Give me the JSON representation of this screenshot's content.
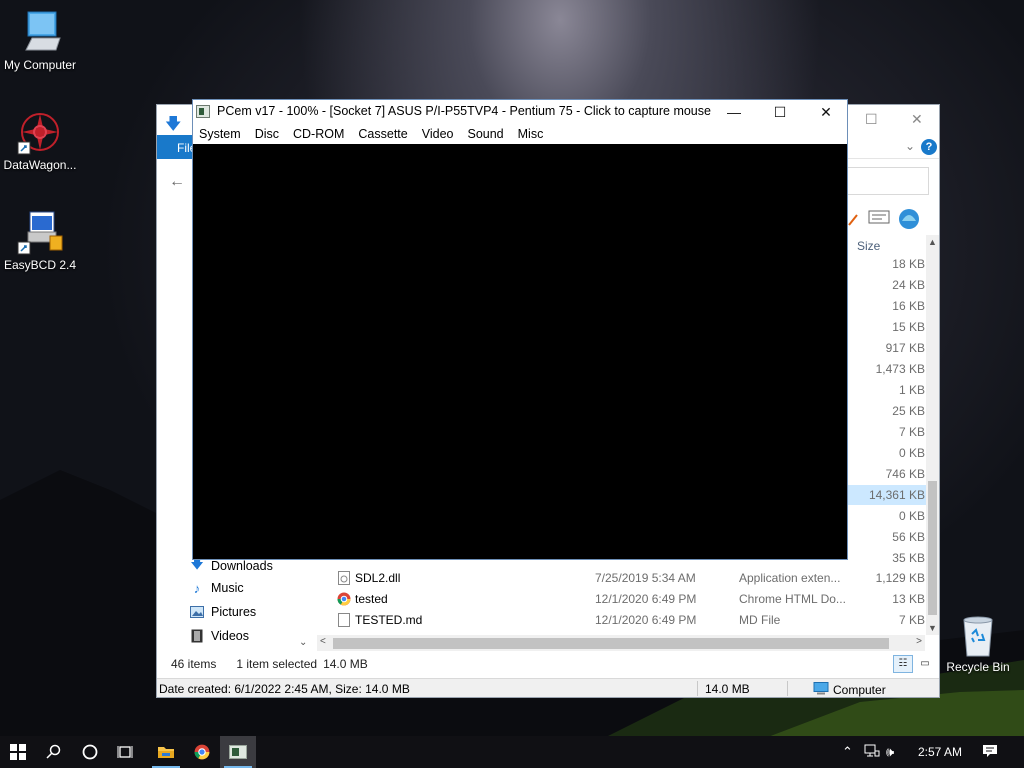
{
  "desktop": {
    "icons": [
      {
        "label": "My Computer"
      },
      {
        "label": "DataWagon..."
      },
      {
        "label": "EasyBCD 2.4"
      },
      {
        "label": "Recycle Bin"
      }
    ]
  },
  "pcem": {
    "title": "PCem v17 - 100% - [Socket 7] ASUS P/I-P55TVP4 - Pentium 75 - Click to capture mouse",
    "minimize": "—",
    "maximize": "☐",
    "close": "✕",
    "menu": [
      "System",
      "Disc",
      "CD-ROM",
      "Cassette",
      "Video",
      "Sound",
      "Misc"
    ]
  },
  "explorer": {
    "ribbon_tab": "File",
    "column_size": "Size",
    "sizes": [
      "18 KB",
      "24 KB",
      "16 KB",
      "15 KB",
      "917 KB",
      "1,473 KB",
      "1 KB",
      "25 KB",
      "7 KB",
      "0 KB",
      "746 KB",
      "14,361 KB",
      "0 KB",
      "56 KB",
      "35 KB"
    ],
    "nav": [
      {
        "label": "Downloads",
        "icon": "download-icon"
      },
      {
        "label": "Music",
        "icon": "music-icon"
      },
      {
        "label": "Pictures",
        "icon": "pictures-icon"
      },
      {
        "label": "Videos",
        "icon": "videos-icon"
      }
    ],
    "files": [
      {
        "name": "SDL2.dll",
        "date": "7/25/2019 5:34 AM",
        "type": "Application exten...",
        "size": "1,129 KB"
      },
      {
        "name": "tested",
        "date": "12/1/2020 6:49 PM",
        "type": "Chrome HTML Do...",
        "size": "13 KB"
      },
      {
        "name": "TESTED.md",
        "date": "12/1/2020 6:49 PM",
        "type": "MD File",
        "size": "7 KB"
      }
    ],
    "status": {
      "items": "46 items",
      "selected": "1 item selected",
      "selected_size": "14.0 MB"
    },
    "details": {
      "info": "Date created: 6/1/2022 2:45 AM, Size: 14.0 MB",
      "size": "14.0 MB",
      "location": "Computer"
    }
  },
  "taskbar": {
    "clock": "2:57 AM"
  }
}
